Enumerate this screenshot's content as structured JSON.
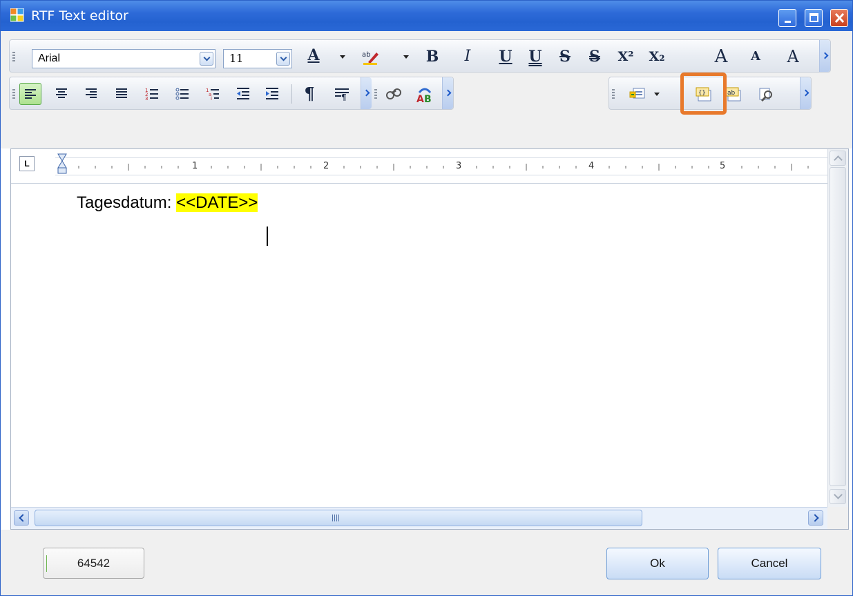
{
  "window": {
    "title": "RTF Text editor",
    "icon": "app-window-icon",
    "controls": [
      "minimize",
      "maximize",
      "close"
    ]
  },
  "toolbar_font": {
    "font_name": "Arial",
    "font_size": "11",
    "items": [
      "font-color",
      "highlight-color",
      "bold",
      "italic",
      "underline",
      "double-underline",
      "strikethrough",
      "double-strikethrough",
      "superscript",
      "subscript",
      "grow-font",
      "shrink-font",
      "change-case"
    ],
    "labels": {
      "bold": "B",
      "italic": "I",
      "underline": "U",
      "double_underline": "U",
      "strike": "S",
      "double_strike": "S",
      "superscript": "X²",
      "subscript": "X₂",
      "grow": "A",
      "shrink": "A",
      "case": "A",
      "font_color": "A",
      "highlight": "ab"
    },
    "colors": {
      "font_color_bar": "#000000",
      "highlight": "#f5c400"
    }
  },
  "toolbar_paragraph": {
    "items": [
      "align-left",
      "align-center",
      "align-right",
      "justify",
      "numbered-list",
      "bullet-list",
      "multilevel-list",
      "decrease-indent",
      "increase-indent",
      "show-paragraph-marks",
      "paragraph-format"
    ],
    "active": "align-left",
    "labels": {
      "pilcrow": "¶"
    }
  },
  "toolbar_tools": {
    "items": [
      "find",
      "spell-check"
    ],
    "labels": {
      "spell": "AB"
    }
  },
  "toolbar_fields": {
    "items": [
      "insert-merge-field",
      "show-field-codes",
      "show-field-results",
      "preview-fields"
    ],
    "highlighted": "show-field-codes",
    "highlight_color": "#e8792b",
    "labels": {
      "field_ab": "ab",
      "field_code": "{}"
    }
  },
  "ruler": {
    "tab_selector": "L",
    "numbers": [
      "1",
      "2",
      "3",
      "4",
      "5"
    ]
  },
  "document": {
    "prefix": "Tagesdatum: ",
    "field_text": "<<DATE>>",
    "field_color": "#ffff00"
  },
  "scrollbar": {
    "thumb_label": "III"
  },
  "footer": {
    "status_value": "64542",
    "ok_label": "Ok",
    "cancel_label": "Cancel"
  }
}
